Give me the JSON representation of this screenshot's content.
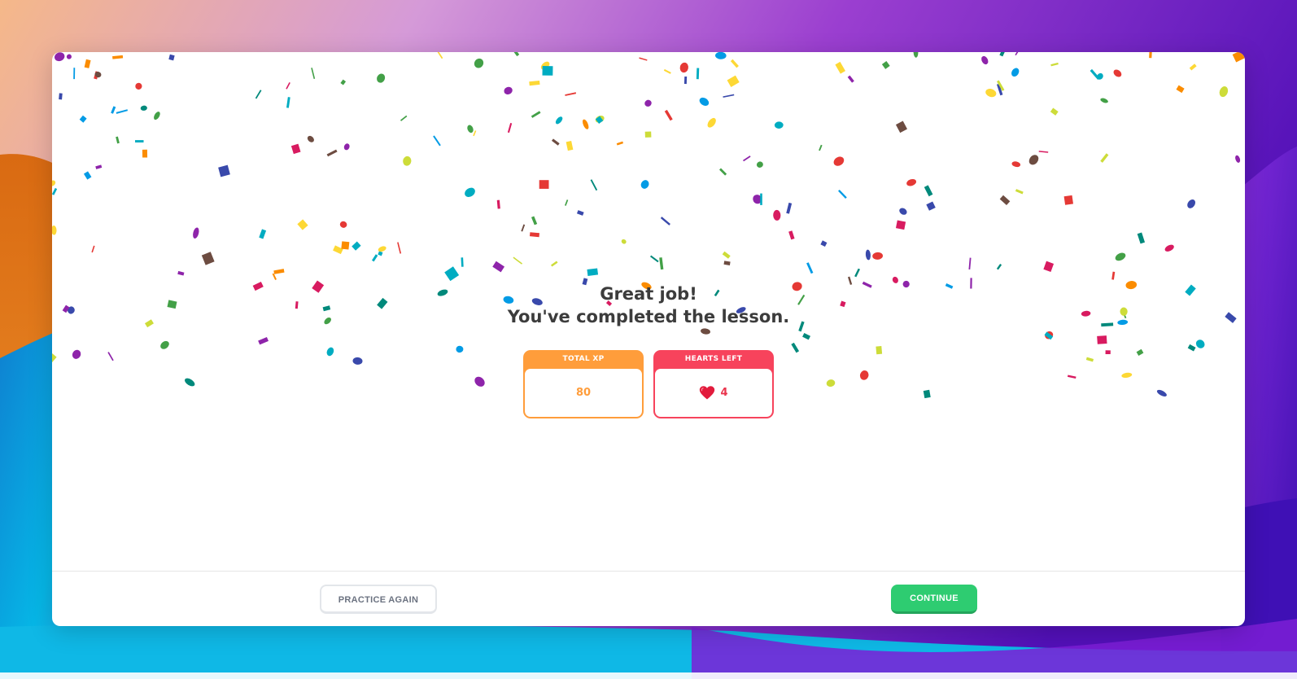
{
  "lesson_complete": {
    "line1": "Great job!",
    "line2": "You've completed the lesson."
  },
  "stats": {
    "total_xp": {
      "label": "TOTAL XP",
      "value": "80",
      "color": "#ff9d3b"
    },
    "hearts_left": {
      "label": "HEARTS LEFT",
      "value": "4",
      "color": "#f7435c",
      "icon": "heart-icon"
    }
  },
  "footer": {
    "practice_again_label": "PRACTICE AGAIN",
    "continue_label": "CONTINUE",
    "continue_color": "#2ecc71"
  },
  "colors": {
    "confetti": [
      "#e53935",
      "#fb8c00",
      "#fdd835",
      "#cddc39",
      "#43a047",
      "#00acc1",
      "#039be5",
      "#3949ab",
      "#8e24aa",
      "#d81b60",
      "#6d4c41",
      "#00897b"
    ]
  }
}
